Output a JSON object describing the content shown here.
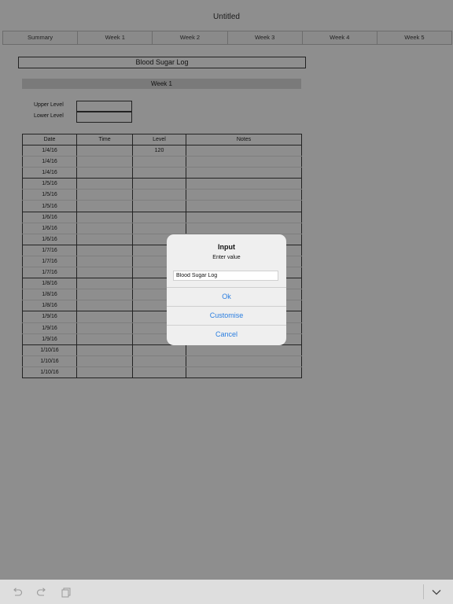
{
  "app": {
    "title": "Untitled"
  },
  "tabs": [
    "Summary",
    "Week 1",
    "Week 2",
    "Week 3",
    "Week 4",
    "Week 5"
  ],
  "sheet": {
    "title": "Blood Sugar Log",
    "week_header": "Week 1",
    "upper_level_label": "Upper Level",
    "lower_level_label": "Lower Level",
    "columns": [
      "Date",
      "Time",
      "Level",
      "Notes"
    ],
    "rows": [
      [
        "1/4/16",
        "",
        "120",
        ""
      ],
      [
        "1/4/16",
        "",
        "",
        ""
      ],
      [
        "1/4/16",
        "",
        "",
        ""
      ],
      [
        "1/5/16",
        "",
        "",
        ""
      ],
      [
        "1/5/16",
        "",
        "",
        ""
      ],
      [
        "1/5/16",
        "",
        "",
        ""
      ],
      [
        "1/6/16",
        "",
        "",
        ""
      ],
      [
        "1/6/16",
        "",
        "",
        ""
      ],
      [
        "1/6/16",
        "",
        "",
        ""
      ],
      [
        "1/7/16",
        "",
        "",
        ""
      ],
      [
        "1/7/16",
        "",
        "",
        ""
      ],
      [
        "1/7/16",
        "",
        "",
        ""
      ],
      [
        "1/8/16",
        "",
        "",
        ""
      ],
      [
        "1/8/16",
        "",
        "",
        ""
      ],
      [
        "1/8/16",
        "",
        "",
        ""
      ],
      [
        "1/9/16",
        "",
        "",
        ""
      ],
      [
        "1/9/16",
        "",
        "",
        ""
      ],
      [
        "1/9/16",
        "",
        "",
        ""
      ],
      [
        "1/10/16",
        "",
        "",
        ""
      ],
      [
        "1/10/16",
        "",
        "",
        ""
      ],
      [
        "1/10/16",
        "",
        "",
        ""
      ]
    ]
  },
  "dialog": {
    "title": "Input",
    "message": "Enter value",
    "input_value": "Blood Sugar Log",
    "ok_label": "Ok",
    "customise_label": "Customise",
    "cancel_label": "Cancel"
  },
  "toolbar": {
    "icons": [
      "undo-icon",
      "redo-icon",
      "copy-icon",
      "chevron-down-icon"
    ]
  },
  "colors": {
    "accent": "#2a7ee0",
    "dim_overlay": "#8e8e8e"
  }
}
